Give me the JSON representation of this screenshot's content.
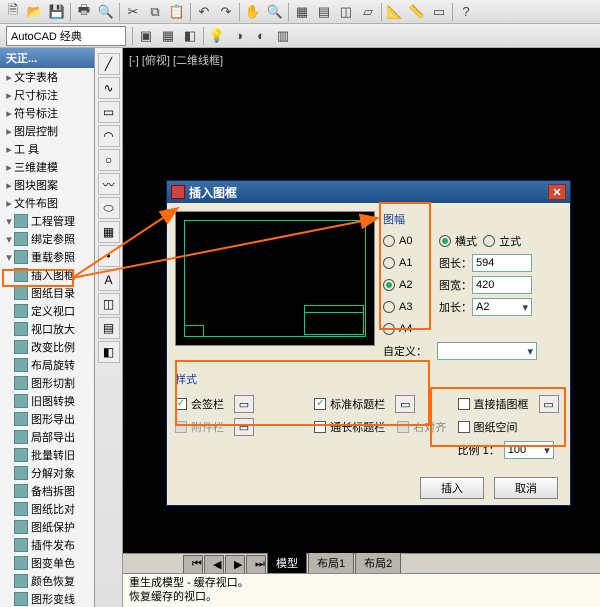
{
  "workspace_combo": "AutoCAD 经典",
  "left_panel": {
    "title": "天正...",
    "items_top": [
      "文字表格",
      "尺寸标注",
      "符号标注",
      "图层控制",
      "工   具",
      "三维建模",
      "图块图案",
      "文件布图"
    ],
    "items_bottom": [
      "工程管理",
      "绑定参照",
      "重载参照",
      "插入图框",
      "图纸目录",
      "定义视口",
      "视口放大",
      "改变比例",
      "布局旋转",
      "图形切割",
      "旧图转换",
      "图形导出",
      "局部导出",
      "批量转旧",
      "分解对象",
      "备档拆图",
      "图纸比对",
      "图纸保护",
      "插件发布",
      "图变单色",
      "颜色恢复",
      "图形变线"
    ]
  },
  "viewport_label": "[-] [俯视] [二维线框]",
  "dialog": {
    "title": "插入图框",
    "tf_title": "图幅",
    "sizes": [
      "A0",
      "A1",
      "A2",
      "A3",
      "A4"
    ],
    "selected_size": "A2",
    "orient_h": "横式",
    "orient_v": "立式",
    "len_label": "图长：",
    "len_value": "594",
    "wid_label": "图宽：",
    "wid_value": "420",
    "ext_label": "加长：",
    "ext_value": "A2",
    "custom_label": "自定义：",
    "style_title": "样式",
    "chk_sign": "会签栏",
    "chk_std": "标准标题栏",
    "chk_attach": "附件栏",
    "chk_full": "通长标题栏",
    "chk_align": "右对齐",
    "chk_direct": "直接插图框",
    "chk_paper": "图纸空间",
    "scale_label": "比例 1：",
    "scale_value": "100",
    "btn_insert": "插入",
    "btn_cancel": "取消"
  },
  "tabs": {
    "model": "模型",
    "layout1": "布局1",
    "layout2": "布局2"
  },
  "cmd_lines": [
    "重生成模型 - 缓存视口。",
    "恢复缓存的视口。"
  ]
}
